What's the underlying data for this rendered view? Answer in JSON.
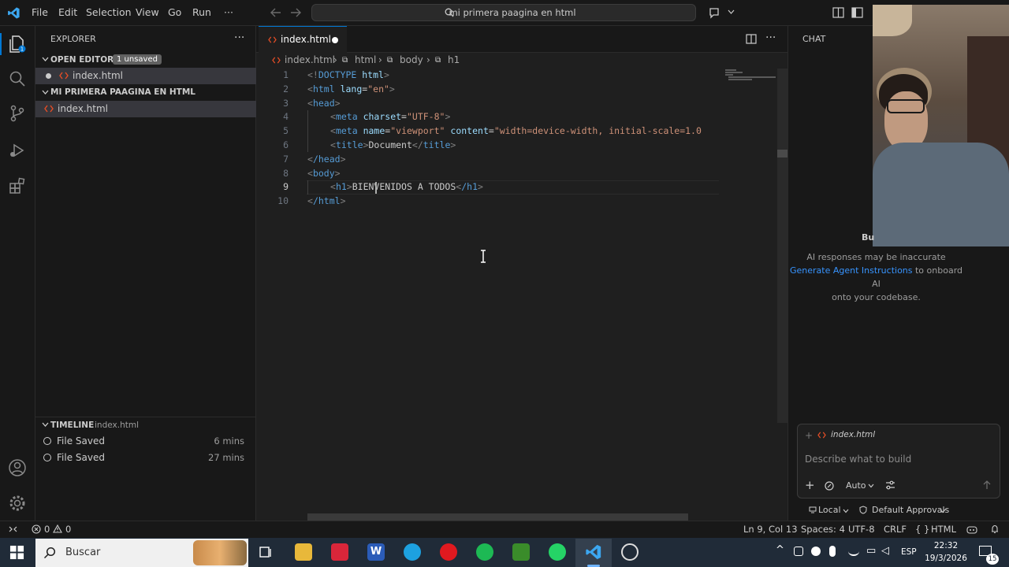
{
  "window": {
    "menu": [
      "File",
      "Edit",
      "Selection",
      "View",
      "Go",
      "Run",
      "···"
    ],
    "search_text": "mi primera paagina en html"
  },
  "explorer": {
    "title": "EXPLORER",
    "open_editors": {
      "label": "OPEN EDITORS",
      "badge": "1 unsaved",
      "file": "index.html"
    },
    "project": {
      "label": "MI PRIMERA PAAGINA EN HTML",
      "file": "index.html"
    },
    "timeline": {
      "label": "TIMELINE",
      "file": "index.html",
      "items": [
        {
          "label": "File Saved",
          "time": "6 mins"
        },
        {
          "label": "File Saved",
          "time": "27 mins"
        }
      ]
    }
  },
  "editor": {
    "tab": "index.html",
    "breadcrumb": [
      "index.html",
      "html",
      "body",
      "h1"
    ],
    "lines": [
      "1",
      "2",
      "3",
      "4",
      "5",
      "6",
      "7",
      "8",
      "9",
      "10"
    ],
    "code": {
      "l1_a": "<!",
      "l1_b": "DOCTYPE",
      "l1_c": " html",
      "l1_d": ">",
      "l2_tag": "html",
      "l2_attr": "lang",
      "l2_val": "\"en\"",
      "l3_tag": "head",
      "l4_tag": "meta",
      "l4_attr": "charset",
      "l4_val": "\"UTF-8\"",
      "l5_tag": "meta",
      "l5_attr1": "name",
      "l5_val1": "\"viewport\"",
      "l5_attr2": "content",
      "l5_val2": "\"width=device-width, initial-scale=1.0",
      "l6_tag": "title",
      "l6_text": "Document",
      "l7_tag": "/head",
      "l8_tag": "body",
      "l9_tag": "h1",
      "l9_text": "BIENVENIDOS A TODOS",
      "l9_close": "/h1",
      "l10_tag": "/html"
    }
  },
  "chat": {
    "title": "CHAT",
    "notice": "AI responses may be inaccurate",
    "link": "Generate Agent Instructions",
    "notice_rest_1": " to onboard AI",
    "notice_rest_2": "onto your codebase.",
    "context_file": "index.html",
    "placeholder": "Describe what to build",
    "mode": "Auto",
    "local": "Local",
    "approvals": "Default Approvals",
    "overlay_text": "Bu"
  },
  "status": {
    "errors": "0",
    "warnings": "0",
    "position": "Ln 9, Col 13",
    "spaces": "Spaces: 4",
    "encoding": "UTF-8",
    "eol": "CRLF",
    "language": "HTML",
    "lang_braces": "{ }"
  },
  "taskbar": {
    "search": "Buscar",
    "lang": "ESP",
    "time": "22:32",
    "date": "19/3/2026",
    "notifications": "15"
  },
  "colors": {
    "accent": "#0078d4",
    "link": "#3794ff"
  }
}
